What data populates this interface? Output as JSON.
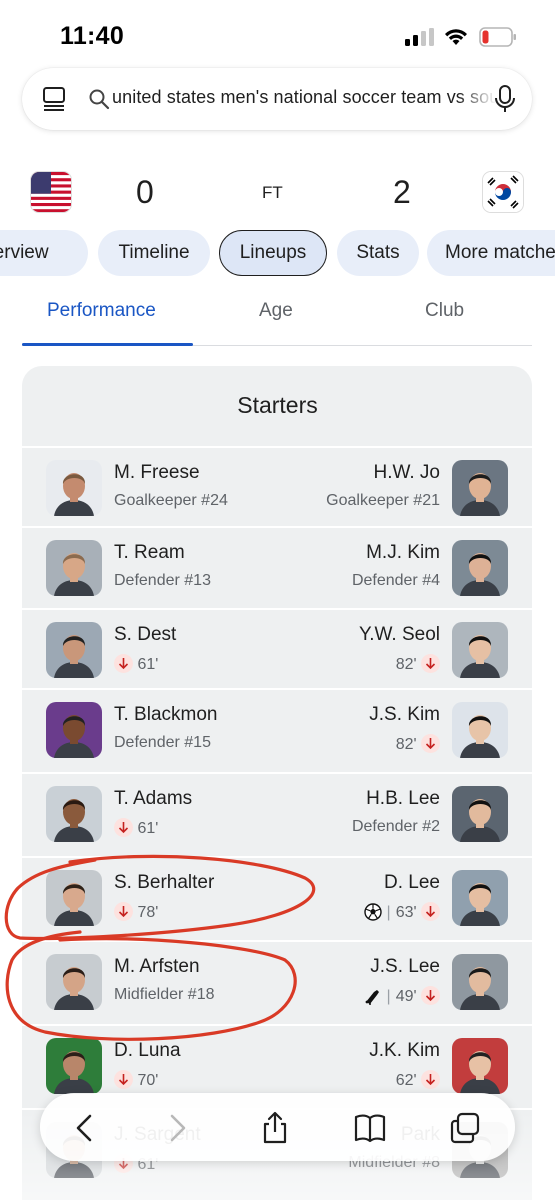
{
  "status_bar": {
    "time": "11:40",
    "icons": [
      "signal-icon",
      "wifi-icon",
      "battery-low-icon"
    ]
  },
  "search": {
    "query": "united states men's national soccer team vs south korea"
  },
  "match": {
    "home_flag": "usa-flag",
    "away_flag": "south-korea-flag",
    "home_score": "0",
    "away_score": "2",
    "status": "FT"
  },
  "chips": [
    {
      "label": "Overview"
    },
    {
      "label": "Timeline"
    },
    {
      "label": "Lineups"
    },
    {
      "label": "Stats"
    },
    {
      "label": "More matches"
    }
  ],
  "segments": [
    {
      "label": "Performance"
    },
    {
      "label": "Age"
    },
    {
      "label": "Club"
    }
  ],
  "starters_title": "Starters",
  "rows": [
    {
      "home": {
        "name": "M. Freese",
        "detail": "Goalkeeper #24"
      },
      "away": {
        "name": "H.W. Jo",
        "detail": "Goalkeeper #21"
      }
    },
    {
      "home": {
        "name": "T. Ream",
        "detail": "Defender #13"
      },
      "away": {
        "name": "M.J. Kim",
        "detail": "Defender #4"
      }
    },
    {
      "home": {
        "name": "S. Dest",
        "minute": "61'"
      },
      "away": {
        "name": "Y.W. Seol",
        "minute": "82'"
      }
    },
    {
      "home": {
        "name": "T. Blackmon",
        "detail": "Defender #15"
      },
      "away": {
        "name": "J.S. Kim",
        "minute": "82'"
      }
    },
    {
      "home": {
        "name": "T. Adams",
        "minute": "61'"
      },
      "away": {
        "name": "H.B. Lee",
        "detail": "Defender #2"
      }
    },
    {
      "home": {
        "name": "S. Berhalter",
        "minute": "78'"
      },
      "away": {
        "name": "D. Lee",
        "minute": "63'"
      }
    },
    {
      "home": {
        "name": "M. Arfsten",
        "detail": "Midfielder #18"
      },
      "away": {
        "name": "J.S. Lee",
        "minute": "49'"
      }
    },
    {
      "home": {
        "name": "D. Luna",
        "minute": "70'"
      },
      "away": {
        "name": "J.K. Kim",
        "minute": "62'"
      }
    },
    {
      "home": {
        "name": "J. Sargent",
        "minute": "61'"
      },
      "away": {
        "name": "Park",
        "detail": "Midfielder #8"
      }
    }
  ],
  "colors": {
    "accent": "#1a56c4",
    "card_bg": "#eef0f1",
    "chip_bg": "#e8eef9",
    "annotation_red": "#d93a26"
  }
}
